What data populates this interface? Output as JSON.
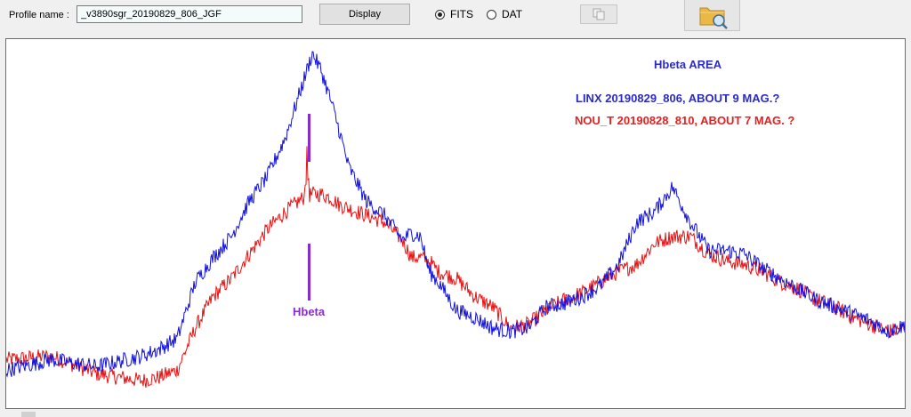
{
  "toolbar": {
    "profile_label": "Profile name :",
    "profile_value": "_v3890sgr_20190829_806_JGF",
    "display_button": "Display",
    "radio_fits": "FITS",
    "radio_dat": "DAT",
    "selected_format": "FITS",
    "copy_icon": "copy-icon",
    "open_folder_icon": "folder-search-icon"
  },
  "annotations": {
    "title": "Hbeta  AREA",
    "line_blue": "LINX 20190829_806,   ABOUT 9 MAG.?",
    "line_red": "NOU_T 20190828_810,  ABOUT 7 MAG. ?",
    "marker_label": "Hbeta",
    "colors": {
      "blue": "#2a2ac8",
      "red": "#e82020",
      "purple": "#8a2bd2"
    }
  },
  "chart_data": {
    "type": "line",
    "title": "Hbeta  AREA",
    "xlabel": "",
    "ylabel": "",
    "series": [
      {
        "name": "LINX 20190829_806,   ABOUT 9 MAG.?",
        "color": "#1010e0",
        "x": [
          0,
          5,
          10,
          15,
          17,
          19,
          21,
          23,
          25,
          27,
          29,
          31,
          33,
          34,
          35,
          36,
          37,
          38,
          40,
          42,
          44,
          45,
          46,
          47,
          48,
          50,
          52,
          54,
          56,
          58,
          60,
          62,
          64,
          66,
          68,
          70,
          72,
          74,
          76,
          78,
          80,
          82,
          84,
          86,
          88,
          90,
          92,
          94,
          96,
          98,
          100
        ],
        "y": [
          0.08,
          0.11,
          0.09,
          0.12,
          0.14,
          0.17,
          0.33,
          0.4,
          0.46,
          0.56,
          0.63,
          0.74,
          0.9,
          0.98,
          0.93,
          0.85,
          0.76,
          0.66,
          0.56,
          0.52,
          0.45,
          0.47,
          0.46,
          0.36,
          0.33,
          0.25,
          0.23,
          0.2,
          0.19,
          0.2,
          0.26,
          0.27,
          0.29,
          0.32,
          0.38,
          0.5,
          0.53,
          0.6,
          0.5,
          0.42,
          0.42,
          0.41,
          0.37,
          0.34,
          0.31,
          0.28,
          0.26,
          0.24,
          0.22,
          0.19,
          0.21
        ]
      },
      {
        "name": "NOU_T 20190828_810,  ABOUT 7 MAG. ?",
        "color": "#e81010",
        "x": [
          0,
          5,
          10,
          15,
          17,
          19,
          21,
          23,
          25,
          27,
          29,
          31,
          33,
          34,
          35,
          36,
          37,
          38,
          40,
          42,
          44,
          45,
          46,
          47,
          48,
          50,
          52,
          54,
          56,
          58,
          60,
          62,
          64,
          66,
          68,
          70,
          72,
          74,
          76,
          78,
          80,
          82,
          84,
          86,
          88,
          90,
          92,
          94,
          96,
          98,
          100
        ],
        "y": [
          0.11,
          0.12,
          0.07,
          0.05,
          0.06,
          0.08,
          0.2,
          0.29,
          0.34,
          0.41,
          0.48,
          0.53,
          0.57,
          0.58,
          0.58,
          0.57,
          0.55,
          0.54,
          0.52,
          0.5,
          0.45,
          0.4,
          0.4,
          0.39,
          0.36,
          0.34,
          0.29,
          0.26,
          0.2,
          0.21,
          0.25,
          0.28,
          0.3,
          0.33,
          0.36,
          0.38,
          0.44,
          0.46,
          0.46,
          0.41,
          0.39,
          0.38,
          0.36,
          0.33,
          0.31,
          0.28,
          0.26,
          0.23,
          0.21,
          0.19,
          0.2
        ]
      }
    ]
  }
}
